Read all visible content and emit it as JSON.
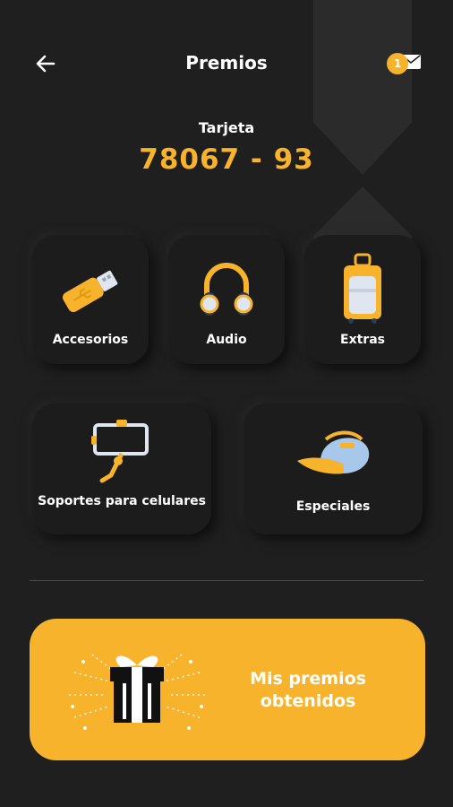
{
  "header": {
    "title": "Premios",
    "notification_count": "1"
  },
  "card": {
    "label": "Tarjeta",
    "number": "78067 - 93"
  },
  "categories": [
    {
      "label": "Accesorios"
    },
    {
      "label": "Audio"
    },
    {
      "label": "Extras"
    },
    {
      "label": "Soportes para celulares"
    },
    {
      "label": "Especiales"
    }
  ],
  "rewards_button": {
    "label": "Mis premios obtenidos"
  },
  "colors": {
    "background": "#1f1f1f",
    "accent": "#f7b32b",
    "tile": "#1c1c1c",
    "text": "#ffffff"
  }
}
